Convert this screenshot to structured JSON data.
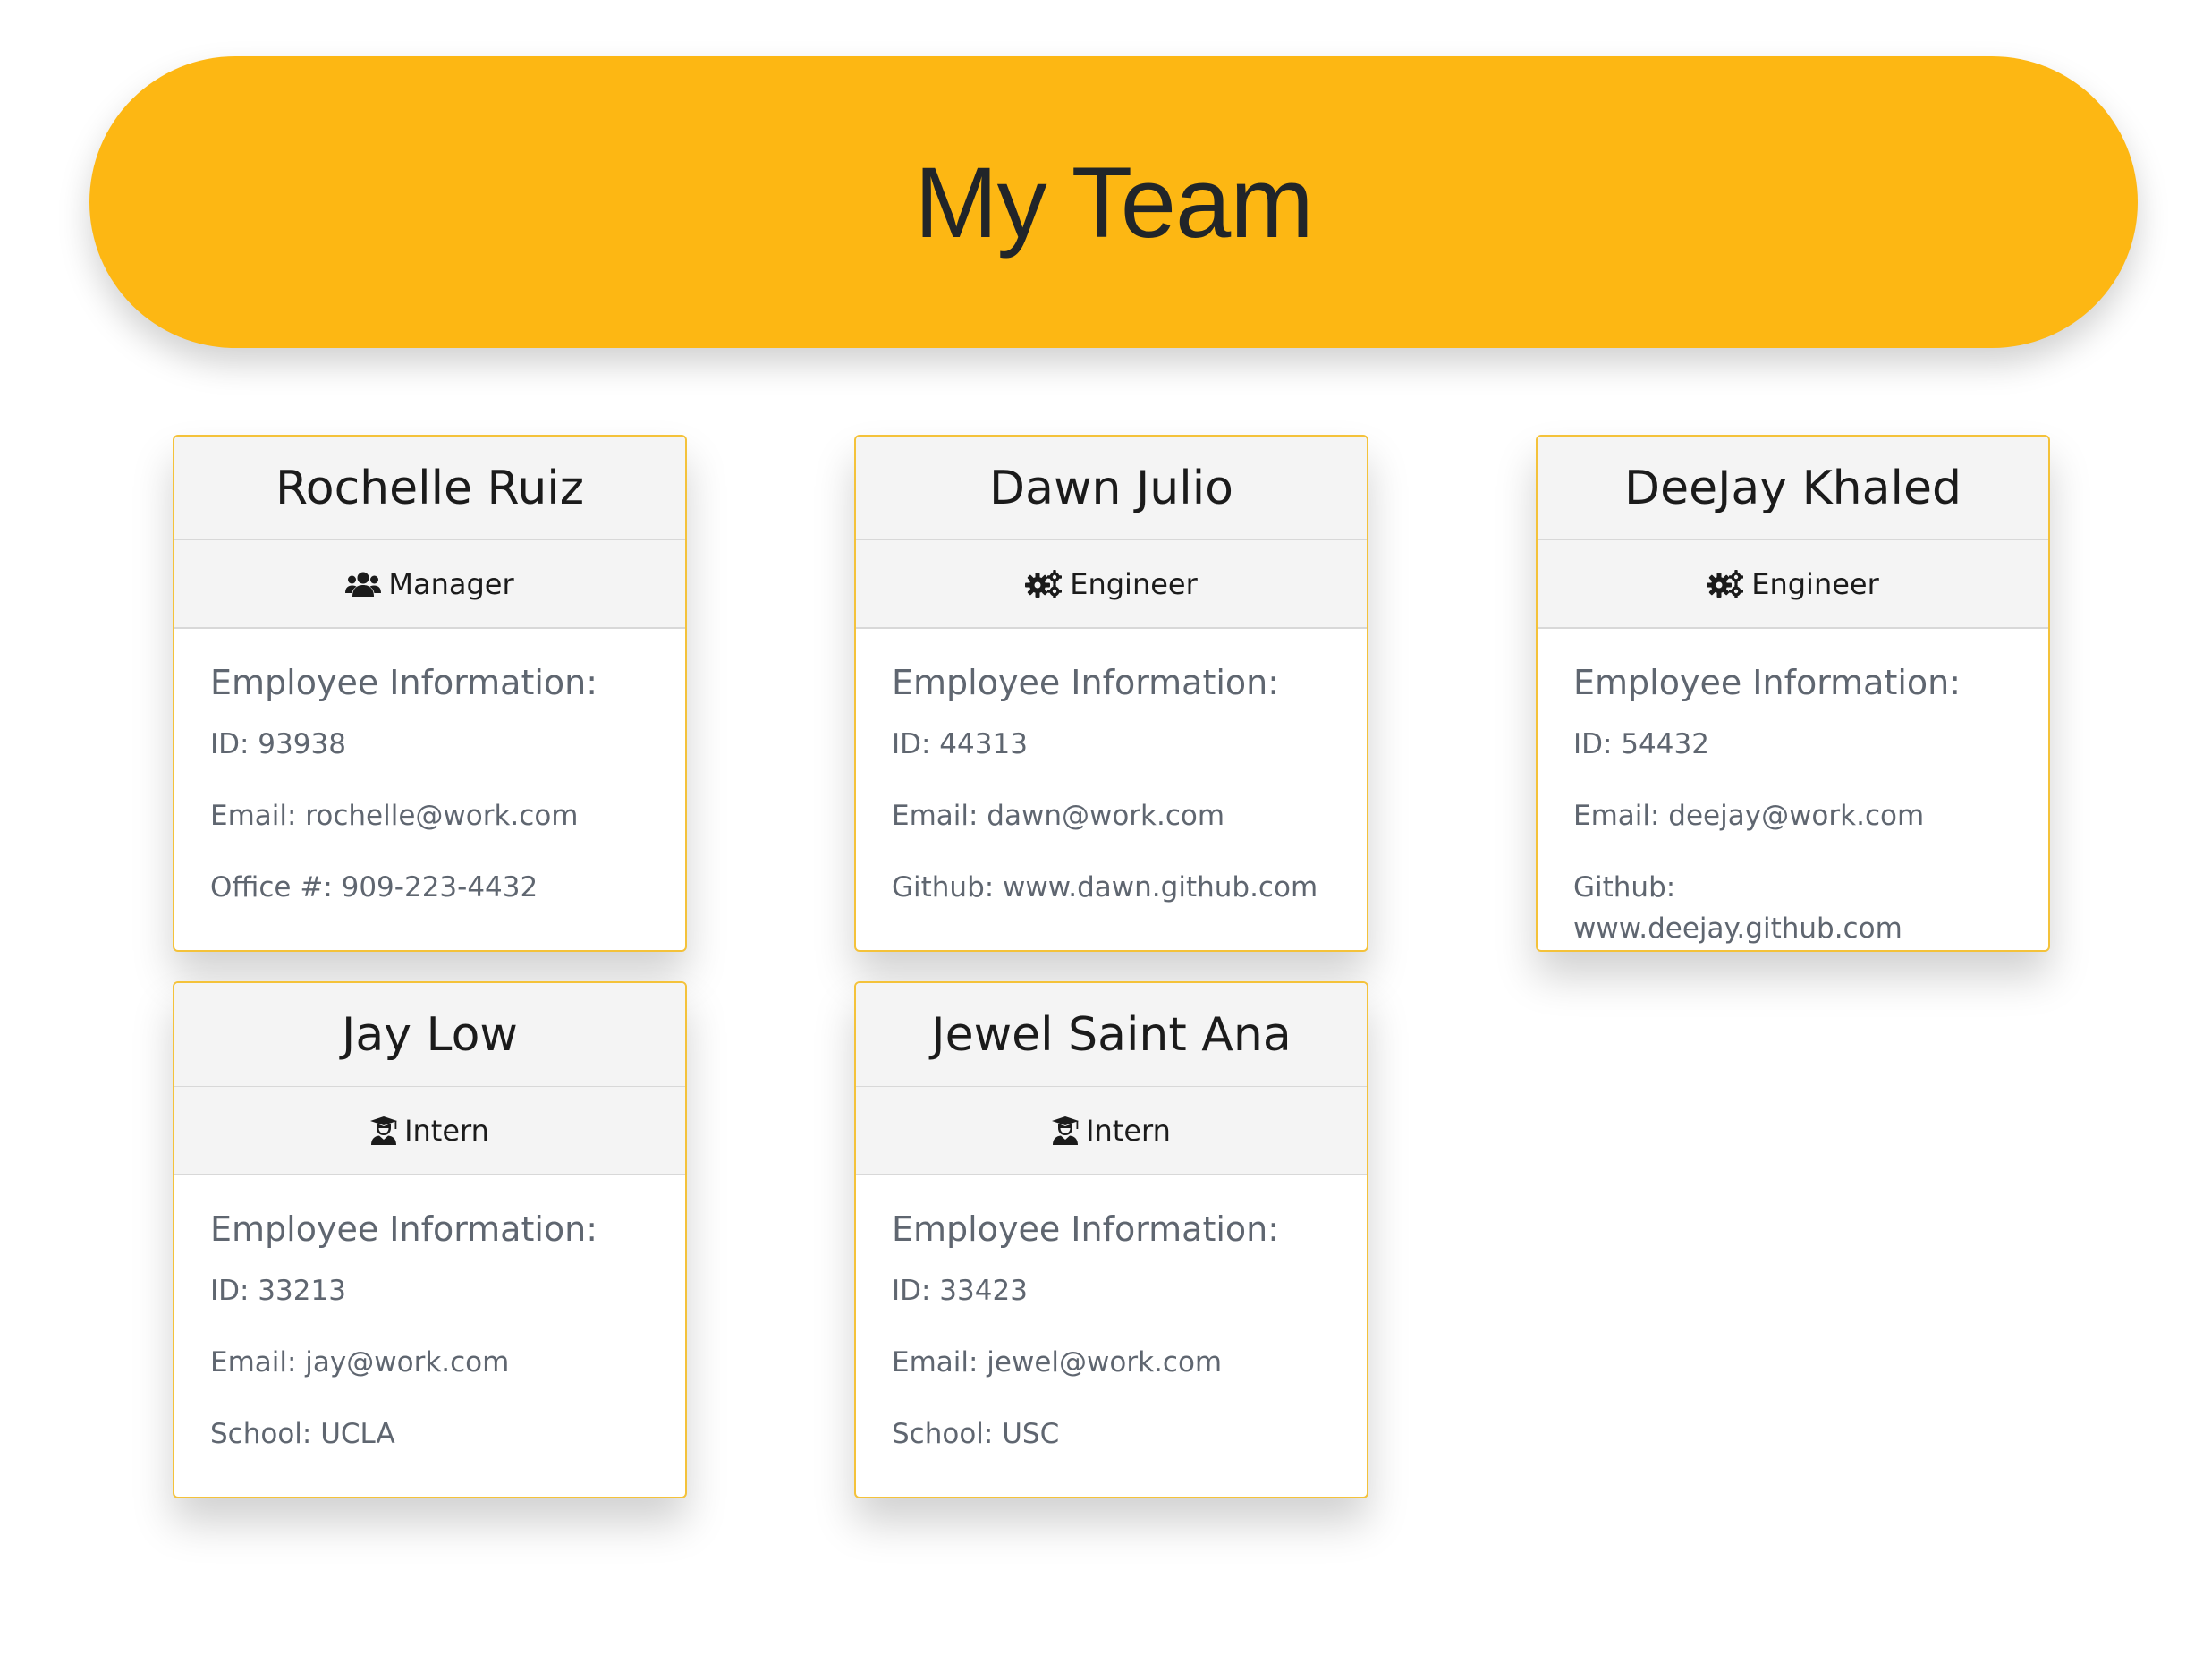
{
  "header": {
    "title": "My Team"
  },
  "info_heading": "Employee Information:",
  "cards": [
    {
      "name": "Rochelle Ruiz",
      "role": "Manager",
      "role_icon": "users-icon",
      "id": "ID: 93938",
      "email": "Email: rochelle@work.com",
      "extra": "Office #: 909-223-4432"
    },
    {
      "name": "Dawn Julio",
      "role": "Engineer",
      "role_icon": "cogs-icon",
      "id": "ID: 44313",
      "email": "Email: dawn@work.com",
      "extra": "Github: www.dawn.github.com"
    },
    {
      "name": "DeeJay Khaled",
      "role": "Engineer",
      "role_icon": "cogs-icon",
      "id": "ID: 54432",
      "email": "Email: deejay@work.com",
      "extra": "Github: www.deejay.github.com"
    },
    {
      "name": "Jay Low",
      "role": "Intern",
      "role_icon": "graduate-icon",
      "id": "ID: 33213",
      "email": "Email: jay@work.com",
      "extra": "School: UCLA"
    },
    {
      "name": "Jewel Saint Ana",
      "role": "Intern",
      "role_icon": "graduate-icon",
      "id": "ID: 33423",
      "email": "Email: jewel@work.com",
      "extra": "School: USC"
    }
  ],
  "colors": {
    "hero_bg": "#fdb713",
    "card_border": "#f4c23a",
    "card_header_bg": "#f4f4f4",
    "muted_text": "#5f6670"
  }
}
